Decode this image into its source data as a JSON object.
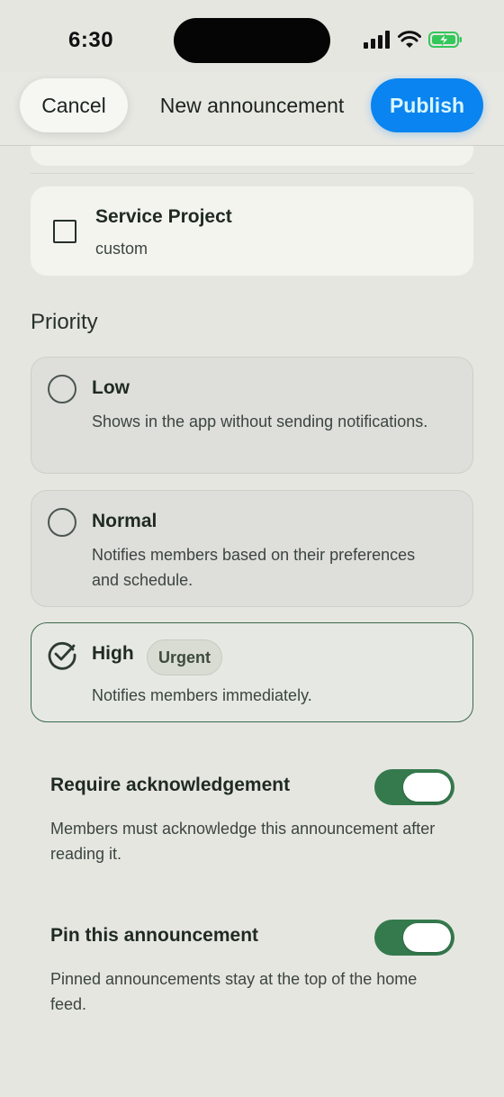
{
  "status_bar": {
    "time": "6:30"
  },
  "header": {
    "cancel_label": "Cancel",
    "title": "New announcement",
    "publish_label": "Publish"
  },
  "tag_option": {
    "title": "Service Project",
    "subtitle": "custom",
    "checked": false
  },
  "priority": {
    "label": "Priority",
    "options": [
      {
        "title": "Low",
        "description": "Shows in the app without sending notifications.",
        "selected": false
      },
      {
        "title": "Normal",
        "description": "Notifies members based on their preferences and schedule.",
        "selected": false
      },
      {
        "title": "High",
        "badge": "Urgent",
        "description": "Notifies members immediately.",
        "selected": true
      }
    ]
  },
  "settings": [
    {
      "title": "Require acknowledgement",
      "description": "Members must acknowledge this announcement after reading it.",
      "enabled": true
    },
    {
      "title": "Pin this announcement",
      "description": "Pinned announcements stay at the top of the home feed.",
      "enabled": true
    }
  ],
  "colors": {
    "background": "#e6e6e1",
    "accent_blue": "#0a84f0",
    "toggle_green": "#357a4d",
    "selected_border": "#3c6a4c"
  },
  "icons": [
    "signal-icon",
    "wifi-icon",
    "battery-charging-icon",
    "checkbox-icon",
    "radio-icon",
    "check-circle-icon"
  ]
}
